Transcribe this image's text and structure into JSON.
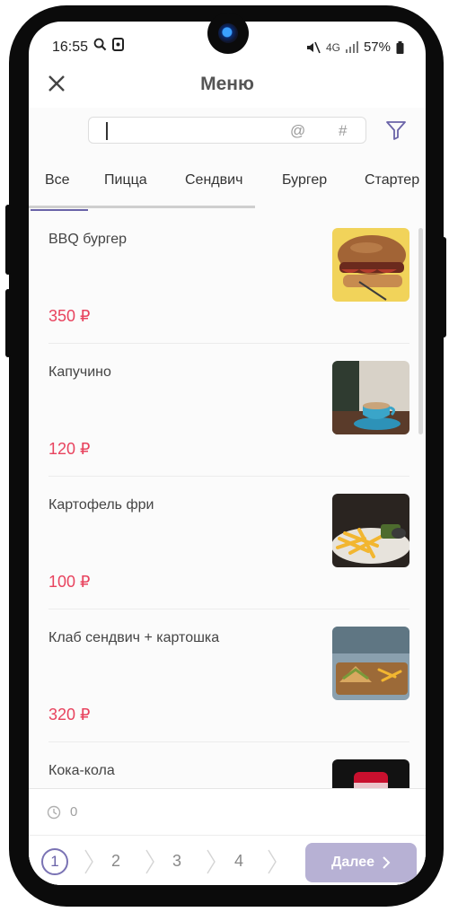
{
  "status_bar": {
    "time": "16:55",
    "left_icons": [
      "search-icon",
      "screenshot-icon"
    ],
    "network": "4G",
    "battery": "57%"
  },
  "header": {
    "title": "Меню",
    "close_icon": "close-icon"
  },
  "search": {
    "value": "",
    "at_label": "@",
    "hash_label": "#"
  },
  "tabs": [
    {
      "label": "Все",
      "active": true
    },
    {
      "label": "Пицца"
    },
    {
      "label": "Сендвич"
    },
    {
      "label": "Бургер"
    },
    {
      "label": "Стартер"
    }
  ],
  "items": [
    {
      "name": "BBQ бургер",
      "price": "350 ₽",
      "image": "burger-photo"
    },
    {
      "name": "Капучино",
      "price": "120 ₽",
      "image": "coffee-photo"
    },
    {
      "name": "Картофель фри",
      "price": "100 ₽",
      "image": "fries-photo"
    },
    {
      "name": "Клаб сендвич + картошка",
      "price": "320 ₽",
      "image": "sandwich-photo"
    },
    {
      "name": "Кока-кола",
      "price": "",
      "image": "cola-photo"
    }
  ],
  "summary": {
    "count": "0"
  },
  "steps": [
    "1",
    "2",
    "3",
    "4"
  ],
  "next_label": "Далее",
  "colors": {
    "accent": "#6a63a8",
    "price": "#e8435e",
    "next_button": "#b7b1d4"
  }
}
